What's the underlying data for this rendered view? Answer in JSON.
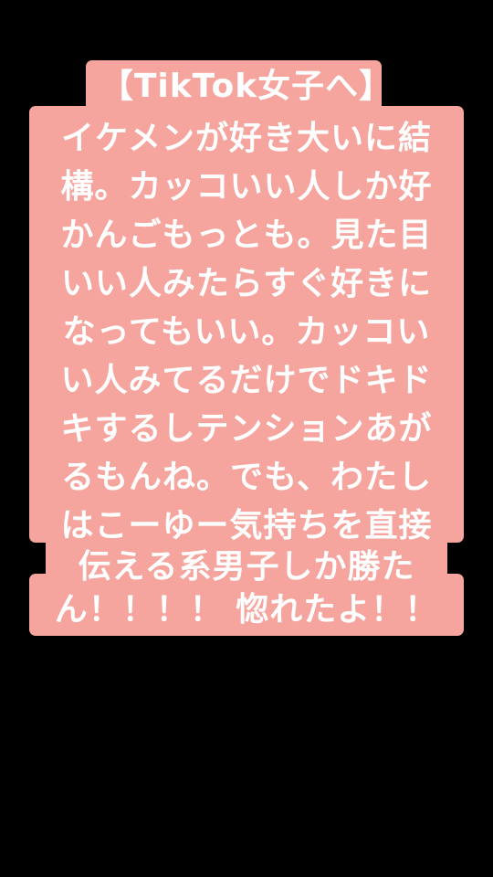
{
  "caption": {
    "background_color": "#f6a59e",
    "text_color": "#ffffff",
    "lines": [
      "【TikTok女子へ】",
      "イケメンが好き大いに結",
      "構。カッコいい人しか好",
      "かんごもっとも。見た目",
      "いい人みたらすぐ好きに",
      "なってもいい。カッコい",
      "い人みてるだけでドキド",
      "キするしテンションあが",
      "るもんね。でも、わたし",
      "はこーゆー気持ちを直接",
      "伝える系男子しか勝た",
      "ん！！！！ 惚れたよ！！"
    ]
  }
}
